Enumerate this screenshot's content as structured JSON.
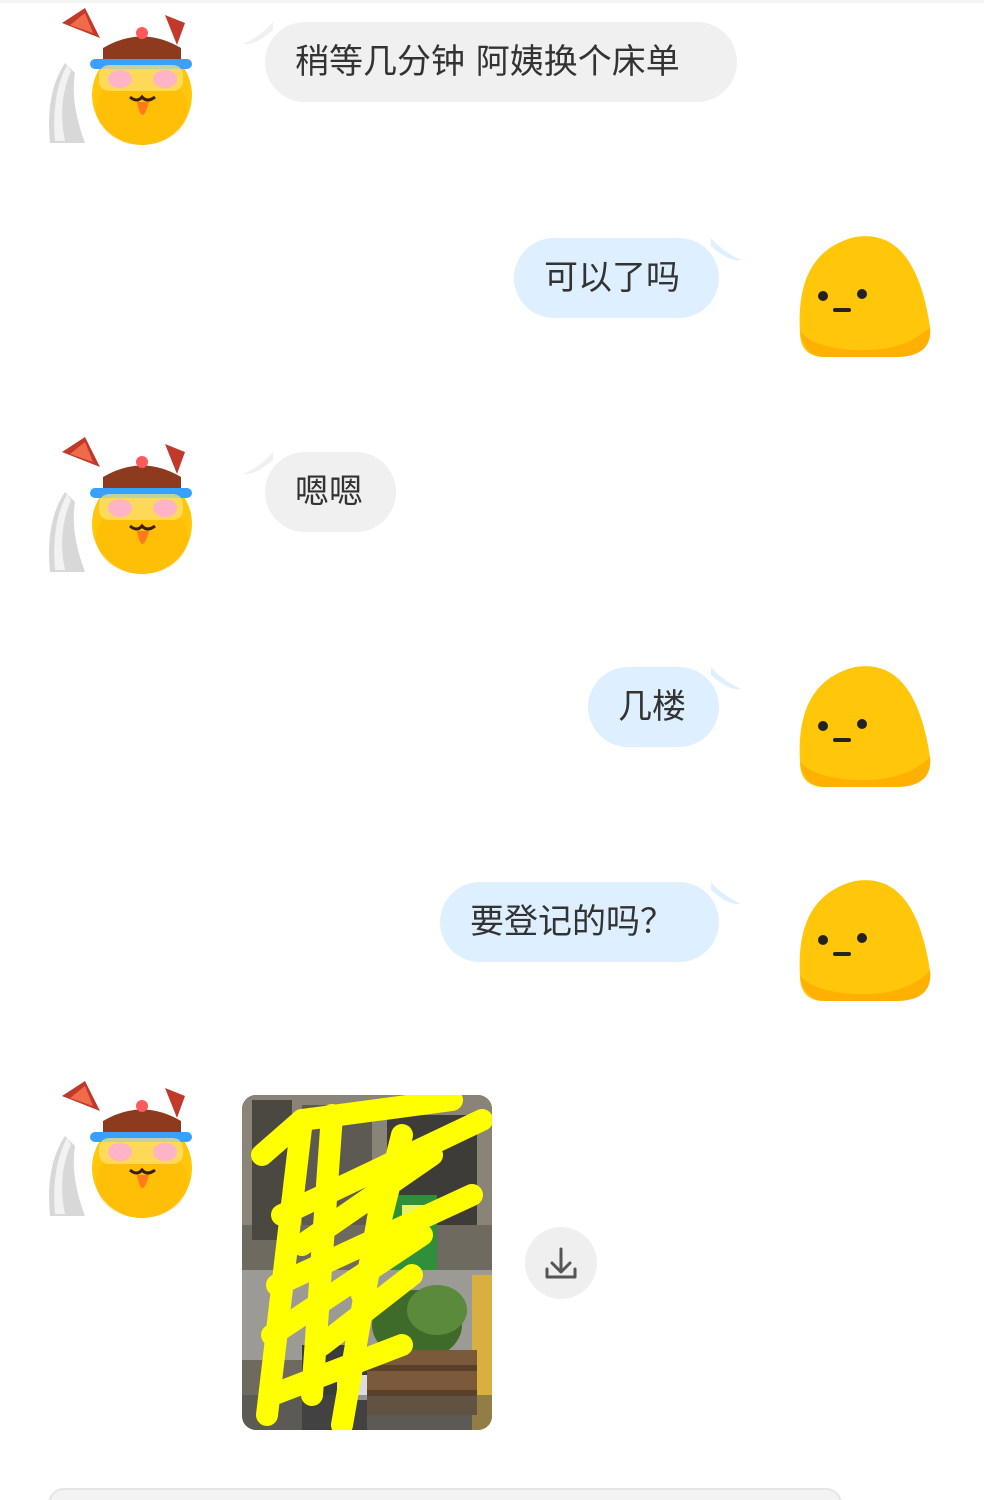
{
  "messages": [
    {
      "side": "left",
      "text": "稍等几分钟 阿姨换个床单"
    },
    {
      "side": "right",
      "text": "可以了吗"
    },
    {
      "side": "left",
      "text": "嗯嗯"
    },
    {
      "side": "right",
      "text": "几楼"
    },
    {
      "side": "right",
      "text": "要登记的吗？"
    },
    {
      "side": "left",
      "type": "image",
      "icon": "photo-thumbnail"
    }
  ],
  "icons": {
    "other_avatar": "cat-mascot-avatar-icon",
    "self_avatar": "yellow-blob-avatar-icon",
    "download": "download-icon"
  },
  "colors": {
    "left_bubble": "#f0f0f0",
    "right_bubble": "#deefff",
    "text": "#333333",
    "avatar_yellow": "#ffc60a",
    "scribble": "#ffff00"
  }
}
